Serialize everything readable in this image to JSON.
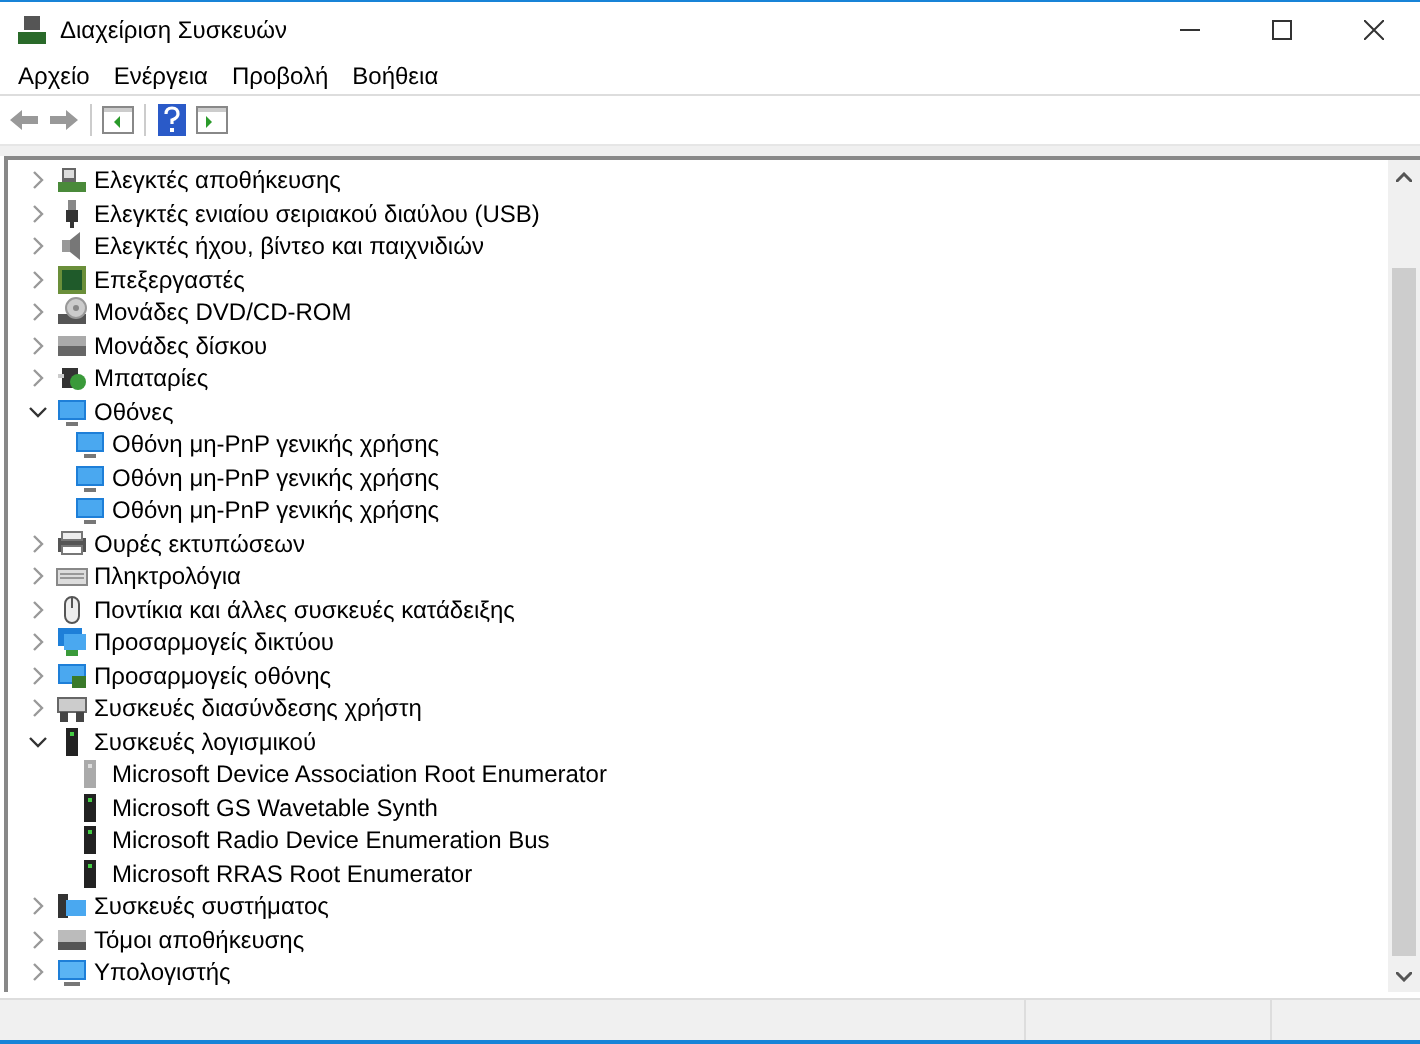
{
  "window": {
    "title": "Διαχείριση Συσκευών"
  },
  "menu": [
    "Αρχείο",
    "Ενέργεια",
    "Προβολή",
    "Βοήθεια"
  ],
  "tree": [
    {
      "label": "Ελεγκτές αποθήκευσης",
      "expanded": false
    },
    {
      "label": "Ελεγκτές ενιαίου σειριακού διαύλου (USB)",
      "expanded": false
    },
    {
      "label": "Ελεγκτές ήχου, βίντεο και παιχνιδιών",
      "expanded": false
    },
    {
      "label": "Επεξεργαστές",
      "expanded": false
    },
    {
      "label": "Μονάδες DVD/CD-ROM",
      "expanded": false
    },
    {
      "label": "Μονάδες δίσκου",
      "expanded": false
    },
    {
      "label": "Μπαταρίες",
      "expanded": false
    },
    {
      "label": "Οθόνες",
      "expanded": true,
      "children": [
        {
          "label": "Οθόνη μη-PnP γενικής χρήσης"
        },
        {
          "label": "Οθόνη μη-PnP γενικής χρήσης"
        },
        {
          "label": "Οθόνη μη-PnP γενικής χρήσης"
        }
      ]
    },
    {
      "label": "Ουρές εκτυπώσεων",
      "expanded": false
    },
    {
      "label": "Πληκτρολόγια",
      "expanded": false
    },
    {
      "label": "Ποντίκια και άλλες συσκευές κατάδειξης",
      "expanded": false
    },
    {
      "label": "Προσαρμογείς δικτύου",
      "expanded": false
    },
    {
      "label": "Προσαρμογείς οθόνης",
      "expanded": false
    },
    {
      "label": "Συσκευές διασύνδεσης χρήστη",
      "expanded": false
    },
    {
      "label": "Συσκευές λογισμικού",
      "expanded": true,
      "children": [
        {
          "label": "Microsoft Device Association Root Enumerator",
          "disabled": true
        },
        {
          "label": "Microsoft GS Wavetable Synth",
          "disabled": false
        },
        {
          "label": "Microsoft Radio Device Enumeration Bus",
          "disabled": false
        },
        {
          "label": "Microsoft RRAS Root Enumerator",
          "disabled": false
        }
      ]
    },
    {
      "label": "Συσκευές συστήματος",
      "expanded": false
    },
    {
      "label": "Τόμοι αποθήκευσης",
      "expanded": false
    },
    {
      "label": "Υπολογιστής",
      "expanded": false
    }
  ]
}
